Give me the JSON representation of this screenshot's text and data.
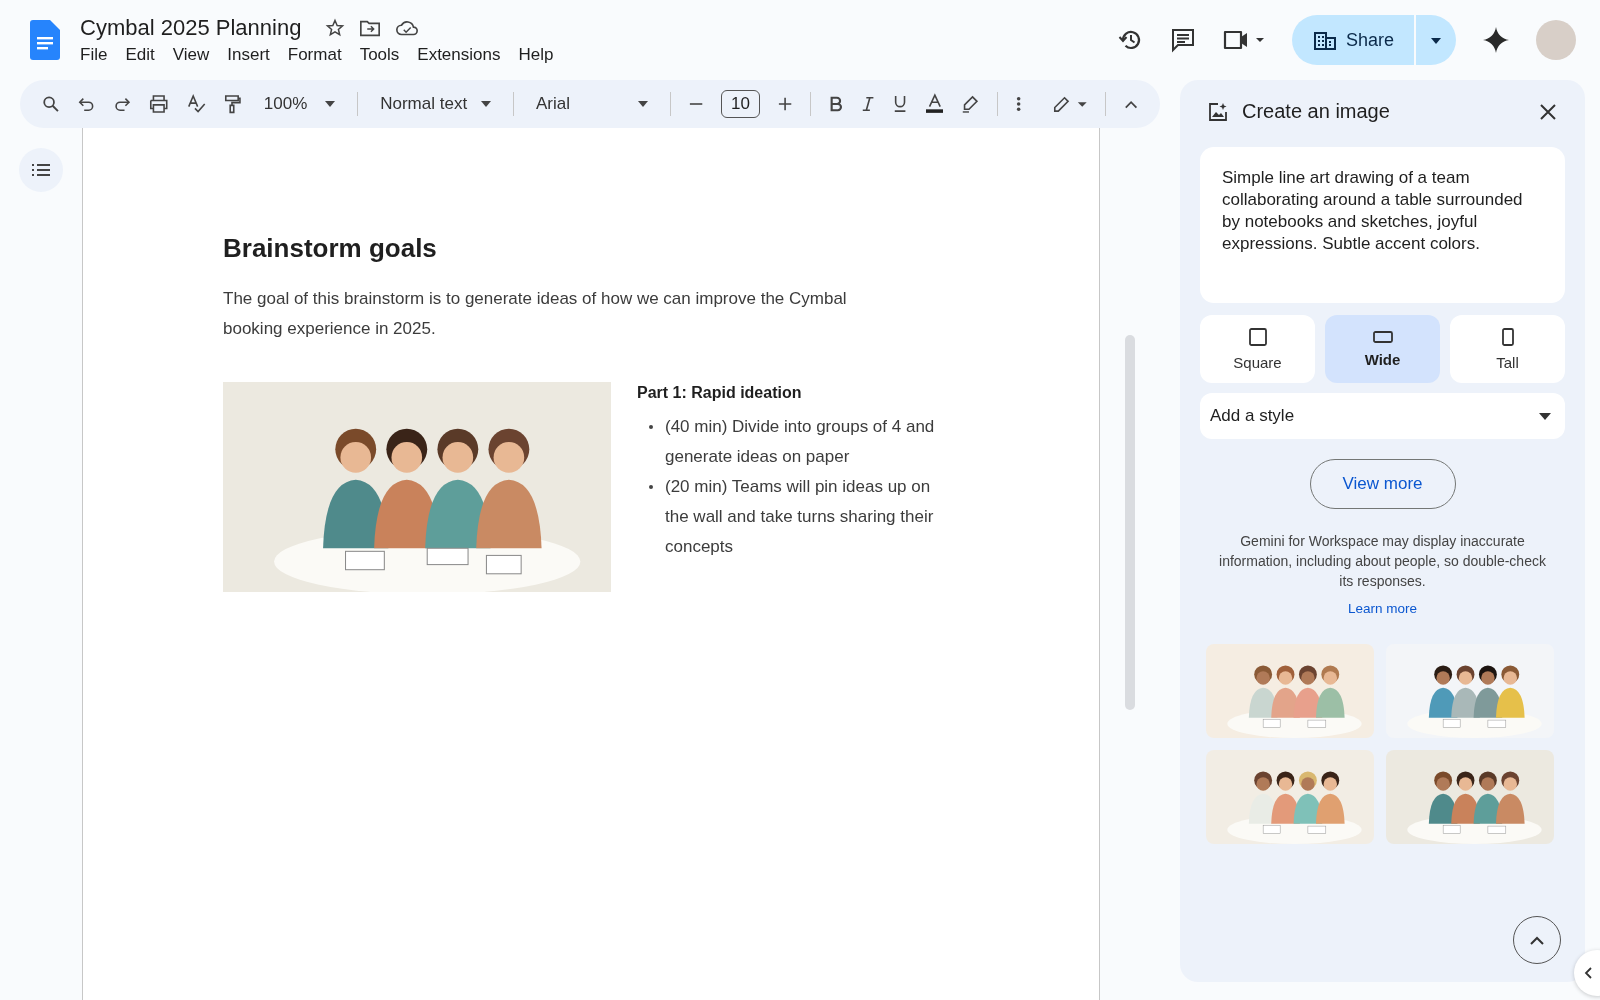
{
  "app": {
    "title": "Cymbal 2025 Planning",
    "menu": [
      "File",
      "Edit",
      "View",
      "Insert",
      "Format",
      "Tools",
      "Extensions",
      "Help"
    ]
  },
  "header": {
    "share_label": "Share"
  },
  "toolbar": {
    "zoom": "100%",
    "style": "Normal text",
    "font": "Arial",
    "font_size": "10"
  },
  "document": {
    "heading": "Brainstorm goals",
    "intro": "The goal of this brainstorm is to generate ideas of how we can improve the Cymbal booking experience in 2025.",
    "image": {
      "kind": "picture"
    },
    "section_title": "Part 1: Rapid ideation",
    "bullets": [
      "(40 min) Divide into groups of 4 and generate ideas on paper",
      "(20 min) Teams will pin ideas up on the wall and take turns sharing their concepts"
    ]
  },
  "panel": {
    "title": "Create an image",
    "prompt": "Simple line art drawing of a team collaborating around a table surrounded by notebooks and sketches, joyful expressions. Subtle accent colors.",
    "aspect_options": [
      {
        "label": "Square",
        "kind": "square",
        "selected": false
      },
      {
        "label": "Wide",
        "kind": "wide",
        "selected": true
      },
      {
        "label": "Tall",
        "kind": "tall",
        "selected": false
      }
    ],
    "style_select": "Add a style",
    "view_more": "View more",
    "disclaimer": "Gemini for Workspace may display inaccurate information, including about people, so double-check its responses.",
    "learn_more": "Learn more",
    "results": [
      {
        "kind": "picture"
      },
      {
        "kind": "picture"
      },
      {
        "kind": "picture"
      },
      {
        "kind": "picture"
      }
    ]
  }
}
